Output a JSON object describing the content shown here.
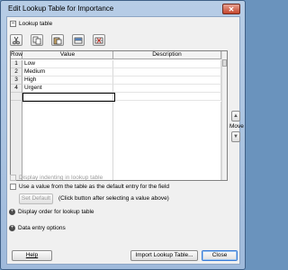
{
  "window": {
    "title": "Edit Lookup Table for Importance",
    "close_glyph": "✕"
  },
  "lookup_section": {
    "toggle": "−",
    "label": "Lookup table"
  },
  "toolbar": {
    "buttons": [
      {
        "name": "cut-icon"
      },
      {
        "name": "copy-icon"
      },
      {
        "name": "paste-icon"
      },
      {
        "name": "insert-row-icon"
      },
      {
        "name": "delete-row-icon"
      }
    ]
  },
  "grid": {
    "columns": {
      "row": "Row",
      "value": "Value",
      "description": "Description"
    },
    "rows": [
      {
        "num": "1",
        "value": "Low",
        "description": ""
      },
      {
        "num": "2",
        "value": "Medium",
        "description": ""
      },
      {
        "num": "3",
        "value": "High",
        "description": ""
      },
      {
        "num": "4",
        "value": "Urgent",
        "description": ""
      },
      {
        "num": "",
        "value": "",
        "description": ""
      }
    ]
  },
  "move": {
    "label": "Move",
    "up": "▲",
    "down": "▼"
  },
  "options": {
    "display_indenting": "Display indenting in lookup table",
    "use_default": "Use a value from the table as the default entry for the field",
    "set_default_button": "Set Default",
    "set_default_hint": "(Click button after selecting a value above)"
  },
  "sections": {
    "display_order": {
      "toggle": "+",
      "label": "Display order for lookup table"
    },
    "data_entry": {
      "toggle": "+",
      "label": "Data entry options"
    }
  },
  "footer": {
    "help": "Help",
    "import": "Import Lookup Table...",
    "close": "Close"
  }
}
